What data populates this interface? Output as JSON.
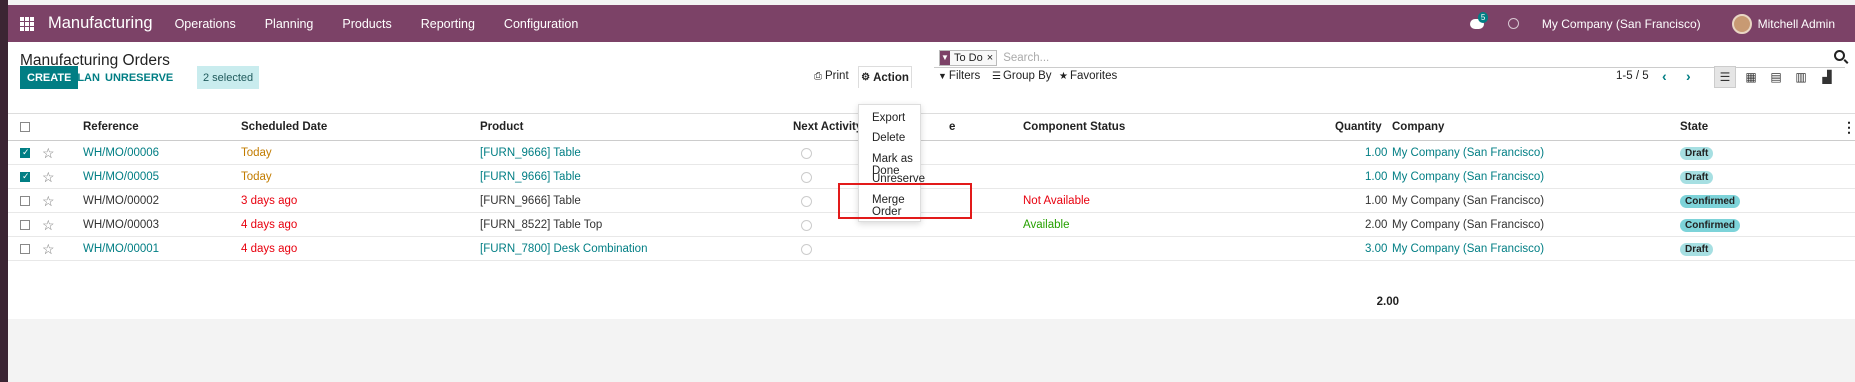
{
  "topbar": {
    "brand": "Manufacturing",
    "menu": [
      "Operations",
      "Planning",
      "Products",
      "Reporting",
      "Configuration"
    ],
    "chat_count": "5",
    "company": "My Company (San Francisco)",
    "user": "Mitchell Admin"
  },
  "control_panel": {
    "title": "Manufacturing Orders",
    "facet": "To Do",
    "search_placeholder": "Search...",
    "create": "CREATE",
    "plan": "PLAN",
    "unreserve": "UNRESERVE",
    "selected": "2 selected",
    "print": "Print",
    "action": "Action",
    "filters": "Filters",
    "group_by": "Group By",
    "favorites": "Favorites",
    "pager": "1-5 / 5"
  },
  "action_menu": [
    "Export",
    "Delete",
    "Mark as Done",
    "Unreserve",
    "Merge Order"
  ],
  "columns": {
    "reference": "Reference",
    "scheduled_date": "Scheduled Date",
    "product": "Product",
    "next_activity": "Next Activity",
    "hidden_suffix": "e",
    "component_status": "Component Status",
    "quantity": "Quantity",
    "company": "Company",
    "state": "State"
  },
  "rows": [
    {
      "ref": "WH/MO/00006",
      "date": "Today",
      "product": "[FURN_9666] Table",
      "component": "",
      "qty": "1.00",
      "company": "My Company (San Francisco)",
      "state": "Draft"
    },
    {
      "ref": "WH/MO/00005",
      "date": "Today",
      "product": "[FURN_9666] Table",
      "component": "",
      "qty": "1.00",
      "company": "My Company (San Francisco)",
      "state": "Draft"
    },
    {
      "ref": "WH/MO/00002",
      "date": "3 days ago",
      "product": "[FURN_9666] Table",
      "component": "Not Available",
      "qty": "1.00",
      "company": "My Company (San Francisco)",
      "state": "Confirmed"
    },
    {
      "ref": "WH/MO/00003",
      "date": "4 days ago",
      "product": "[FURN_8522] Table Top",
      "component": "Available",
      "qty": "2.00",
      "company": "My Company (San Francisco)",
      "state": "Confirmed"
    },
    {
      "ref": "WH/MO/00001",
      "date": "4 days ago",
      "product": "[FURN_7800] Desk Combination",
      "component": "",
      "qty": "3.00",
      "company": "My Company (San Francisco)",
      "state": "Draft"
    }
  ],
  "total_qty": "2.00",
  "colors": {
    "brand": "#7c4267",
    "accent": "#017e84",
    "danger": "#e8000e",
    "warning": "#c27c00",
    "success": "#26a000"
  }
}
